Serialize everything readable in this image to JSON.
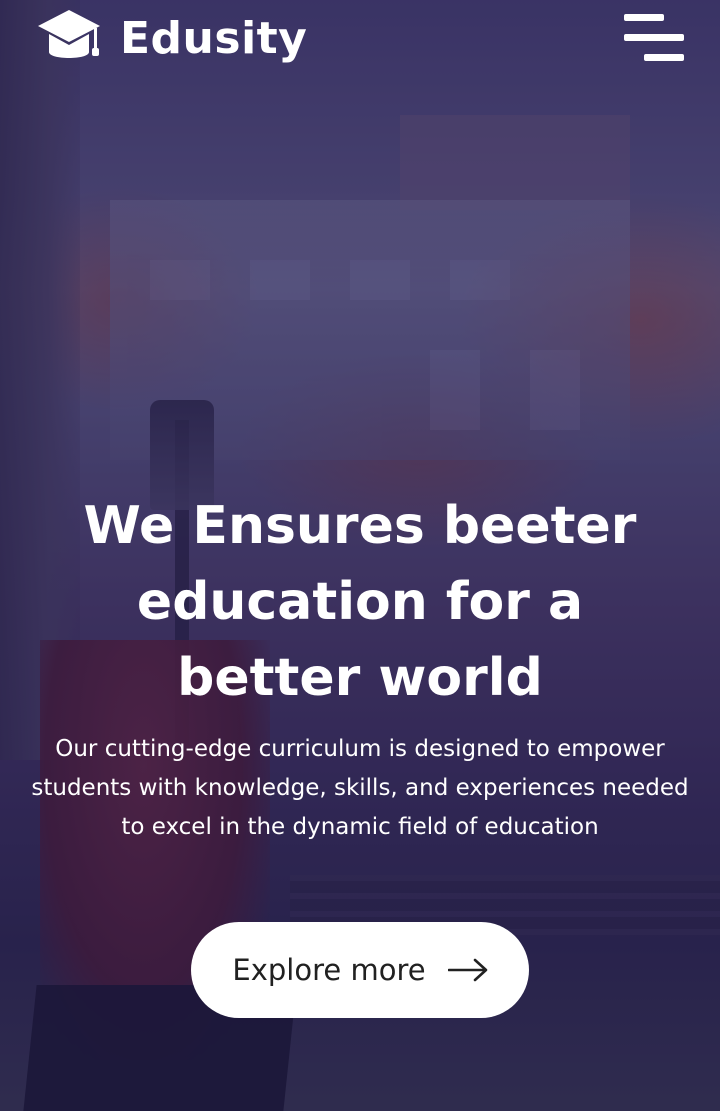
{
  "brand": {
    "name": "Edusity"
  },
  "nav": {
    "menu_icon": "hamburger-menu-icon"
  },
  "hero": {
    "title": "We Ensures beeter education for a better world",
    "description": "Our cutting-edge curriculum is designed to empower students with knowledge, skills, and experiences needed to excel in the dynamic field of education",
    "button_label": "Explore more",
    "button_icon": "arrow-right-icon"
  },
  "colors": {
    "overlay": "#1e1450",
    "text": "#ffffff",
    "button_bg": "#ffffff",
    "button_text": "#212121"
  }
}
